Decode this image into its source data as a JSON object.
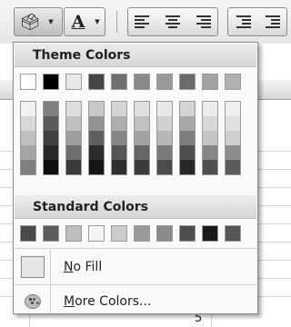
{
  "toolbar": {
    "fill_icon": "paint-bucket-icon",
    "font_color_letter": "A",
    "align_buttons": [
      "align-left-icon",
      "align-center-icon",
      "align-right-icon"
    ],
    "indent_buttons": [
      "decrease-indent-icon",
      "increase-indent-icon"
    ]
  },
  "sheet": {
    "visible_cell_value": "5"
  },
  "dropdown": {
    "theme_colors_label": "Theme Colors",
    "theme_colors": [
      "#ffffff",
      "#000000",
      "#e8e8e8",
      "#444444",
      "#707070",
      "#8a8a8a",
      "#9a9a9a",
      "#6a6a6a",
      "#a3a3a3",
      "#b0b0b0"
    ],
    "shades": [
      [
        "#f2f2f2",
        "#d9d9d9",
        "#bfbfbf",
        "#a6a6a6",
        "#808080"
      ],
      [
        "#7f7f7f",
        "#595959",
        "#404040",
        "#262626",
        "#0d0d0d"
      ],
      [
        "#dddddd",
        "#bfbfbf",
        "#9e9e9e",
        "#6e6e6e",
        "#3a3a3a"
      ],
      [
        "#c8c8c8",
        "#939393",
        "#5e5e5e",
        "#2b2b2b",
        "#151515"
      ],
      [
        "#d6d6d6",
        "#aeaeae",
        "#868686",
        "#555555",
        "#2e2e2e"
      ],
      [
        "#e0e0e0",
        "#c2c2c2",
        "#a3a3a3",
        "#666666",
        "#3a3a3a"
      ],
      [
        "#e8e8e8",
        "#d0d0d0",
        "#b8b8b8",
        "#7a7a7a",
        "#4a4a4a"
      ],
      [
        "#d4d4d4",
        "#a9a9a9",
        "#7e7e7e",
        "#4e4e4e",
        "#262626"
      ],
      [
        "#ececec",
        "#d9d9d9",
        "#c6c6c6",
        "#868686",
        "#505050"
      ],
      [
        "#efefef",
        "#dfdfdf",
        "#cfcfcf",
        "#8c8c8c",
        "#5a5a5a"
      ]
    ],
    "standard_colors_label": "Standard Colors",
    "standard_colors": [
      "#4a4a4a",
      "#5c5c5c",
      "#bdbdbd",
      "#f4f4f4",
      "#cccccc",
      "#9a9a9a",
      "#8a8a8a",
      "#4e4e4e",
      "#1a1a1a",
      "#555555"
    ],
    "no_fill": {
      "mnemonic": "N",
      "rest": "o Fill"
    },
    "more_colors": {
      "mnemonic": "M",
      "rest": "ore Colors..."
    }
  }
}
